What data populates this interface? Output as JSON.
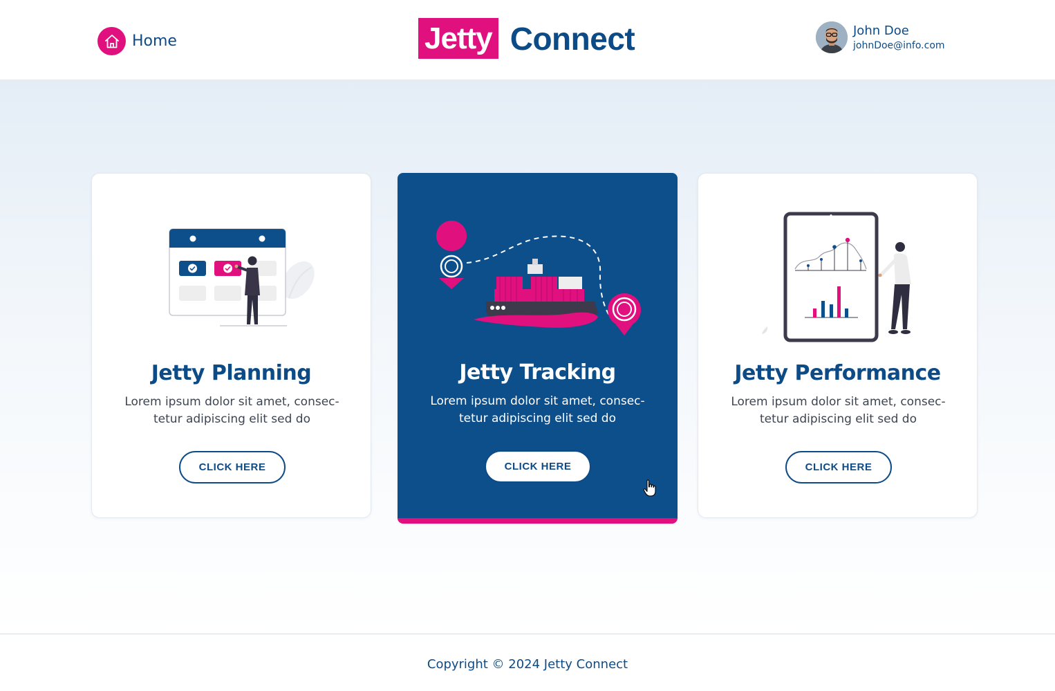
{
  "header": {
    "home_label": "Home",
    "logo_highlight": "Jetty",
    "logo_text": "Connect",
    "user": {
      "name": "John Doe",
      "email": "johnDoe@info.com"
    }
  },
  "cards": [
    {
      "title": "Jetty Planning",
      "description": "Lorem ipsum dolor sit amet, consec- tetur adipiscing elit sed do",
      "button": "CLICK HERE",
      "illustration": "calendar-planning-illustration"
    },
    {
      "title": "Jetty Tracking",
      "description": "Lorem ipsum dolor sit amet, consec- tetur adipiscing elit sed do",
      "button": "CLICK HERE",
      "illustration": "cargo-ship-tracking-illustration",
      "active": true
    },
    {
      "title": "Jetty Performance",
      "description": "Lorem ipsum dolor sit amet, consec- tetur adipiscing elit sed do",
      "button": "CLICK HERE",
      "illustration": "tablet-charts-illustration"
    }
  ],
  "footer": {
    "copyright": "Copyright © 2024 Jetty Connect"
  },
  "colors": {
    "brand_blue": "#0d4b87",
    "brand_pink": "#e0107f"
  }
}
